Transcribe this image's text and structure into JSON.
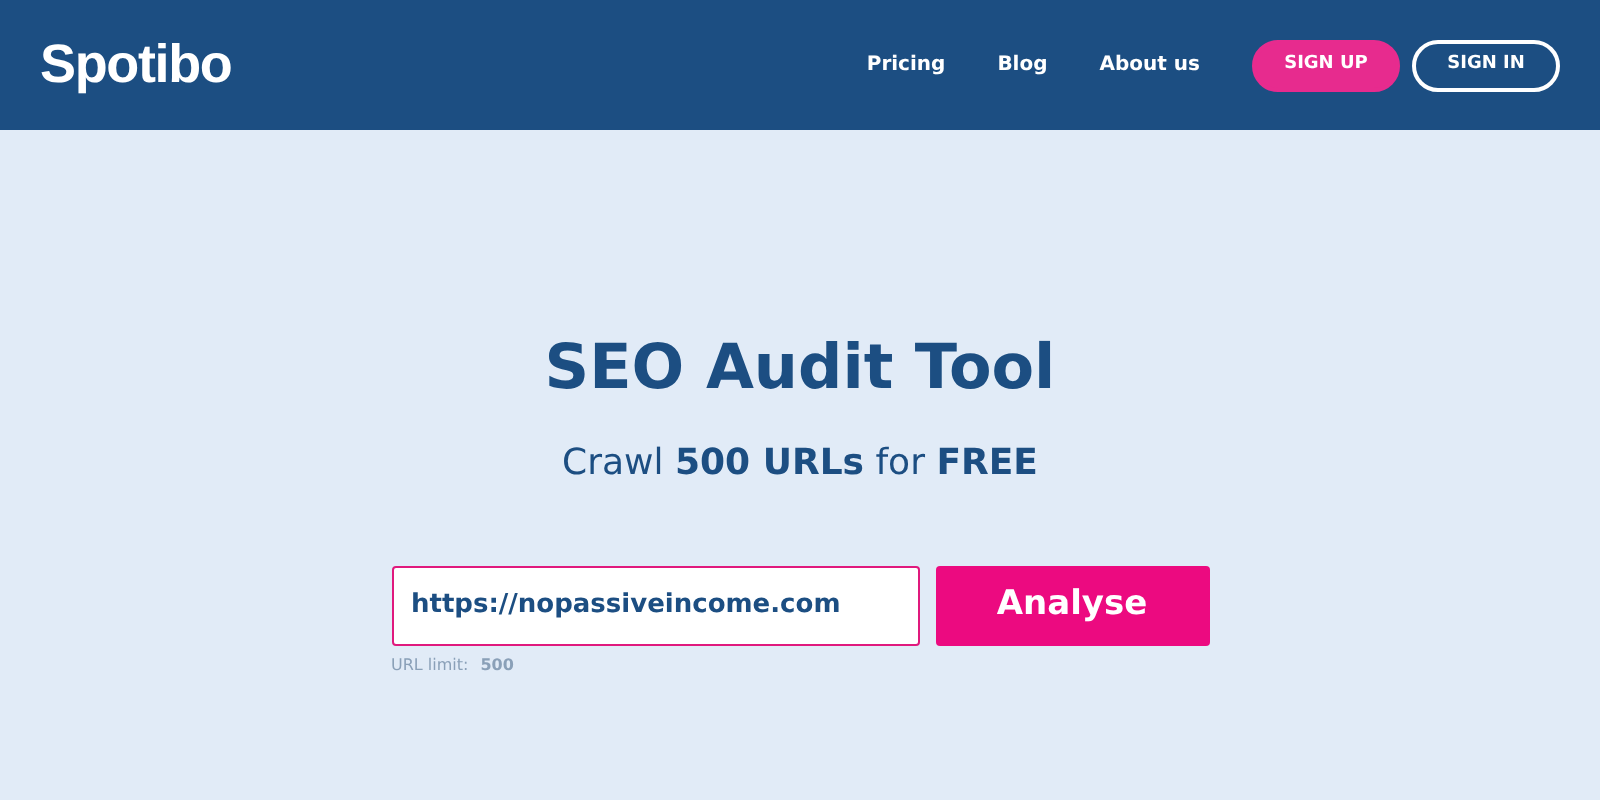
{
  "header": {
    "logo": "Spotibo",
    "nav": [
      "Pricing",
      "Blog",
      "About us"
    ],
    "buttons": [
      {
        "label": "SIGN UP",
        "kind": "filled"
      },
      {
        "label": "SIGN IN",
        "kind": "outline"
      }
    ]
  },
  "hero": {
    "title": "SEO Audit Tool",
    "subtitle": "Crawl **500 URLs** for **FREE**",
    "url_field": {
      "value": "https://nopassiveincome.com"
    },
    "button": "Analyse",
    "limit_label": "URL limit:",
    "limit_value": "500"
  }
}
